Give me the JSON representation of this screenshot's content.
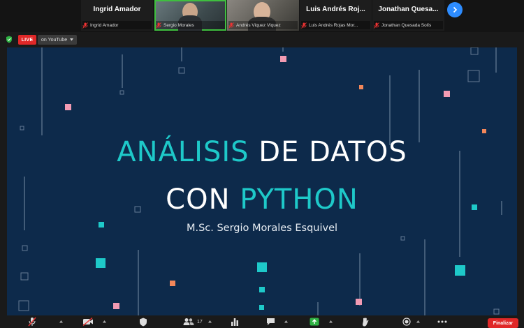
{
  "participants": [
    {
      "name_large": "Ingrid Amador",
      "name_caption": "Ingrid Amador",
      "muted": true,
      "video": false
    },
    {
      "name_large": "",
      "name_caption": "Sergio Morales",
      "muted": true,
      "video": true,
      "active_speaker": true
    },
    {
      "name_large": "",
      "name_caption": "Andrés Viquez Viquez",
      "muted": true,
      "video": true
    },
    {
      "name_large": "Luis Andrés Roj...",
      "name_caption": "Luis Andrés Rojas Mor...",
      "muted": true,
      "video": false
    },
    {
      "name_large": "Jonathan Quesa...",
      "name_caption": "Jonathan Quesada Solís",
      "muted": true,
      "video": false
    }
  ],
  "next_page_icon": "chevron-right-icon",
  "live": {
    "badge": "LIVE",
    "platform_label": "on YouTube",
    "dropdown_icon": "caret-down-icon",
    "security_icon": "shield-check-icon"
  },
  "slide": {
    "title_line1_part1": "ANÁLISIS",
    "title_line1_part2": " DE DATOS",
    "title_line2_part1": "CON ",
    "title_line2_part2": "PYTHON",
    "author": "M.Sc. Sergio Morales Esquivel",
    "colors": {
      "background": "#0d2a4b",
      "accent_cyan": "#1ec9c9",
      "accent_pink": "#f29bb3",
      "accent_orange": "#f2875a"
    }
  },
  "toolbar": {
    "items": [
      {
        "icon": "microphone-muted-icon",
        "has_caret": true
      },
      {
        "icon": "video-off-icon",
        "has_caret": true
      },
      {
        "icon": "security-icon",
        "has_caret": false
      },
      {
        "icon": "participants-icon",
        "count": "17",
        "has_caret": true
      },
      {
        "icon": "polls-icon",
        "has_caret": false
      },
      {
        "icon": "chat-icon",
        "has_caret": true
      },
      {
        "icon": "share-screen-icon",
        "has_caret": true
      },
      {
        "icon": "reactions-icon",
        "has_caret": false
      },
      {
        "icon": "record-icon",
        "has_caret": true
      },
      {
        "icon": "more-icon",
        "has_caret": false
      }
    ],
    "end_label": "Finalizar"
  }
}
